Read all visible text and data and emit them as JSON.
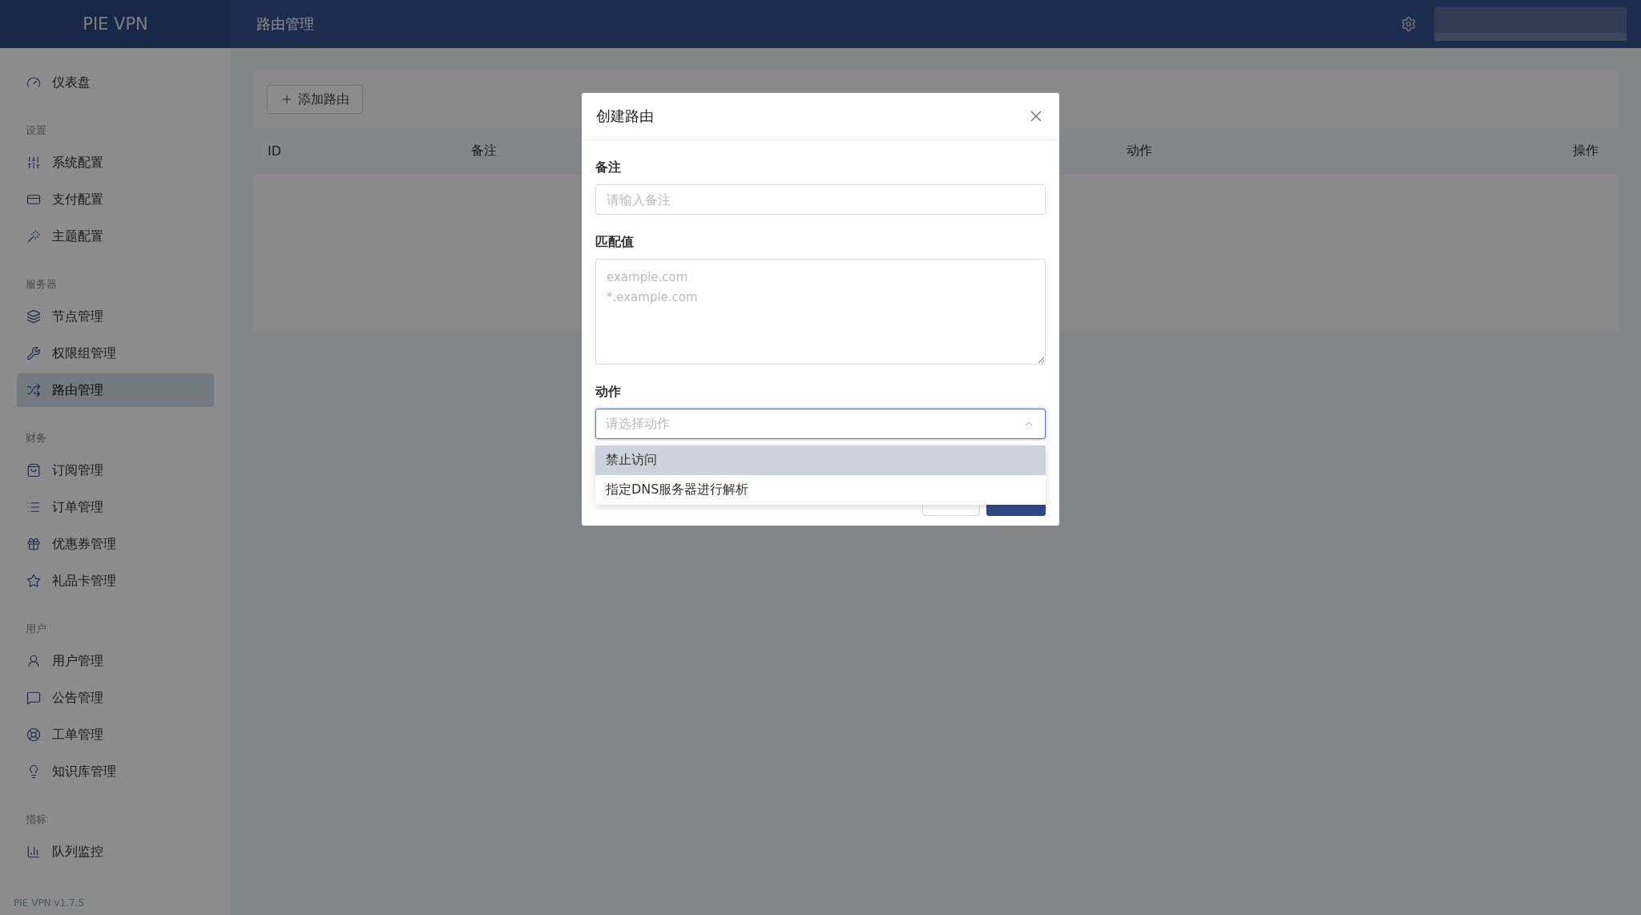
{
  "header": {
    "logo": "PIE VPN",
    "page_title": "路由管理"
  },
  "sidebar": {
    "groups": [
      {
        "items": [
          {
            "label": "仪表盘",
            "selected": false
          }
        ]
      },
      {
        "heading": "设置",
        "items": [
          {
            "label": "系统配置",
            "selected": false
          },
          {
            "label": "支付配置",
            "selected": false
          },
          {
            "label": "主题配置",
            "selected": false
          }
        ]
      },
      {
        "heading": "服务器",
        "items": [
          {
            "label": "节点管理",
            "selected": false
          },
          {
            "label": "权限组管理",
            "selected": false
          },
          {
            "label": "路由管理",
            "selected": true
          }
        ]
      },
      {
        "heading": "财务",
        "items": [
          {
            "label": "订阅管理",
            "selected": false
          },
          {
            "label": "订单管理",
            "selected": false
          },
          {
            "label": "优惠券管理",
            "selected": false
          },
          {
            "label": "礼品卡管理",
            "selected": false
          }
        ]
      },
      {
        "heading": "用户",
        "items": [
          {
            "label": "用户管理",
            "selected": false
          },
          {
            "label": "公告管理",
            "selected": false
          },
          {
            "label": "工单管理",
            "selected": false
          },
          {
            "label": "知识库管理",
            "selected": false
          }
        ]
      },
      {
        "heading": "指标",
        "items": [
          {
            "label": "队列监控",
            "selected": false
          }
        ]
      }
    ],
    "version": "PIE VPN v1.7.5"
  },
  "toolbar": {
    "add_button": "添加路由"
  },
  "table": {
    "columns": [
      "ID",
      "备注",
      "动作",
      "操作"
    ]
  },
  "dialog": {
    "title": "创建路由",
    "fields": [
      {
        "kind": "input",
        "label": "备注",
        "placeholder": "请输入备注"
      },
      {
        "kind": "textarea",
        "label": "匹配值",
        "placeholder": "example.com\n*.example.com"
      },
      {
        "kind": "select",
        "label": "动作",
        "placeholder": "请选择动作",
        "expanded": true,
        "options": [
          {
            "label": "禁止访问",
            "selected": true
          },
          {
            "label": "指定DNS服务器进行解析",
            "selected": false
          }
        ]
      }
    ]
  }
}
